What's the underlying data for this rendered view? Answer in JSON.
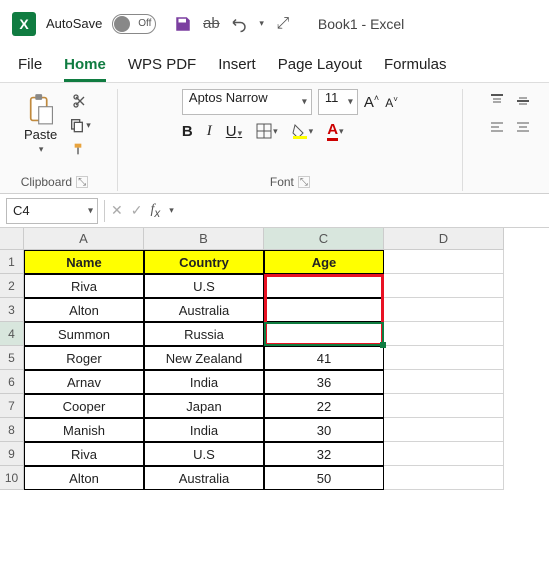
{
  "titlebar": {
    "autosave_label": "AutoSave",
    "autosave_state": "Off",
    "doc_name": "Book1",
    "app_name": "Excel"
  },
  "tabs": [
    "File",
    "Home",
    "WPS PDF",
    "Insert",
    "Page Layout",
    "Formulas"
  ],
  "active_tab": "Home",
  "ribbon": {
    "clipboard": {
      "paste": "Paste",
      "group_label": "Clipboard"
    },
    "font": {
      "family": "Aptos Narrow",
      "size": "11",
      "bold": "B",
      "italic": "I",
      "underline": "U",
      "group_label": "Font",
      "grow": "A",
      "shrink": "A"
    }
  },
  "namebox": "C4",
  "columns": [
    "A",
    "B",
    "C",
    "D"
  ],
  "row_numbers": [
    "1",
    "2",
    "3",
    "4",
    "5",
    "6",
    "7",
    "8",
    "9",
    "10"
  ],
  "table": {
    "headers": {
      "name": "Name",
      "country": "Country",
      "age": "Age"
    },
    "rows": [
      {
        "name": "Riva",
        "country": "U.S",
        "age": ""
      },
      {
        "name": "Alton",
        "country": "Australia",
        "age": ""
      },
      {
        "name": "Summon",
        "country": "Russia",
        "age": ""
      },
      {
        "name": "Roger",
        "country": "New Zealand",
        "age": "41"
      },
      {
        "name": "Arnav",
        "country": "India",
        "age": "36"
      },
      {
        "name": "Cooper",
        "country": "Japan",
        "age": "22"
      },
      {
        "name": "Manish",
        "country": "India",
        "age": "30"
      },
      {
        "name": "Riva",
        "country": "U.S",
        "age": "32"
      },
      {
        "name": "Alton",
        "country": "Australia",
        "age": "50"
      }
    ]
  },
  "selection": {
    "cell": "C4",
    "highlight_range": "C2:C4"
  },
  "colors": {
    "accent": "#107c41",
    "header_fill": "#ffff00",
    "highlight": "#e81123"
  }
}
